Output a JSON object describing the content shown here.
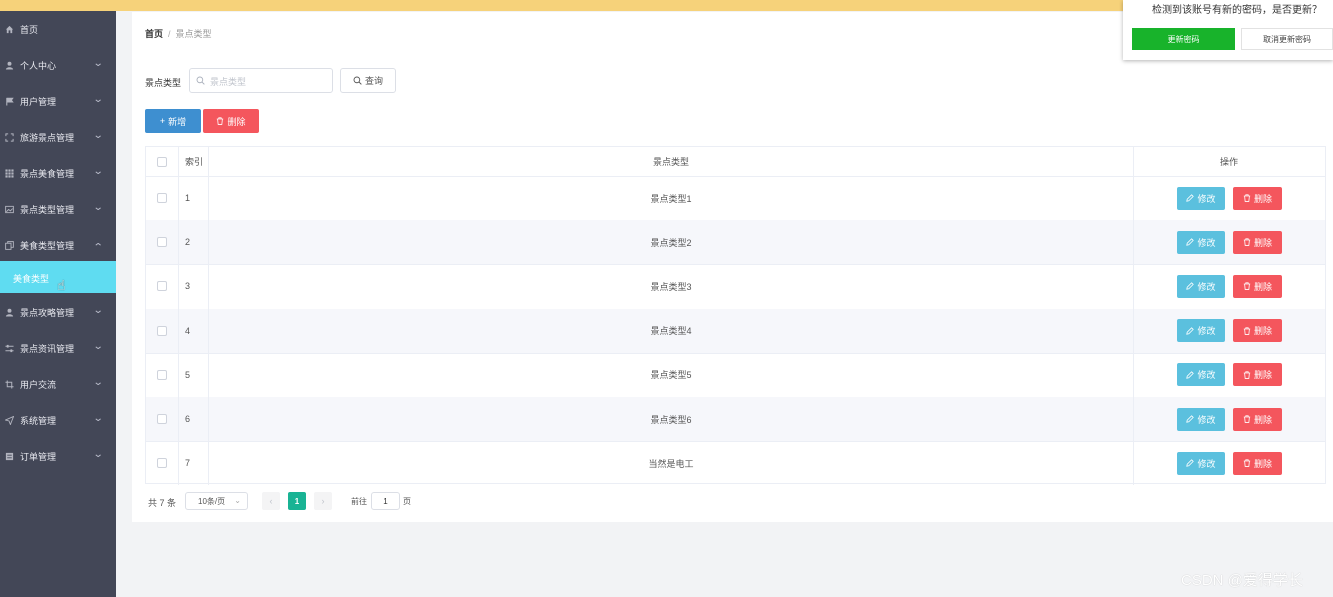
{
  "sidebar": {
    "items": [
      {
        "label": "首页",
        "icon": "home-icon",
        "expandable": false
      },
      {
        "label": "个人中心",
        "icon": "user-icon",
        "expandable": true
      },
      {
        "label": "用户管理",
        "icon": "flag-icon",
        "expandable": true
      },
      {
        "label": "旅游景点管理",
        "icon": "fullscreen-icon",
        "expandable": true
      },
      {
        "label": "景点美食管理",
        "icon": "grid-icon",
        "expandable": true
      },
      {
        "label": "景点类型管理",
        "icon": "picture-icon",
        "expandable": true
      },
      {
        "label": "美食类型管理",
        "icon": "copy-icon",
        "expandable": true,
        "expanded": true
      },
      {
        "label": "景点攻略管理",
        "icon": "user-icon",
        "expandable": true
      },
      {
        "label": "景点资讯管理",
        "icon": "sliders-icon",
        "expandable": true
      },
      {
        "label": "用户交流",
        "icon": "crop-icon",
        "expandable": true
      },
      {
        "label": "系统管理",
        "icon": "send-icon",
        "expandable": true
      },
      {
        "label": "订单管理",
        "icon": "list-icon",
        "expandable": true
      }
    ],
    "active_sub": "美食类型"
  },
  "breadcrumb": {
    "home": "首页",
    "separator": "/",
    "current": "景点类型"
  },
  "search": {
    "label": "景点类型",
    "placeholder": "景点类型",
    "value": "",
    "button": "查询"
  },
  "toolbar": {
    "add": "新增",
    "delete": "删除"
  },
  "table": {
    "headers": {
      "index": "索引",
      "type": "景点类型",
      "ops": "操作"
    },
    "edit_label": "修改",
    "delete_label": "删除",
    "rows": [
      {
        "index": "1",
        "type": "景点类型1"
      },
      {
        "index": "2",
        "type": "景点类型2"
      },
      {
        "index": "3",
        "type": "景点类型3"
      },
      {
        "index": "4",
        "type": "景点类型4"
      },
      {
        "index": "5",
        "type": "景点类型5"
      },
      {
        "index": "6",
        "type": "景点类型6"
      },
      {
        "index": "7",
        "type": "当然是电工"
      }
    ]
  },
  "pagination": {
    "total": "共 7 条",
    "page_size": "10条/页",
    "current_page": "1",
    "goto_label": "前往",
    "goto_value": "1",
    "page_unit": "页"
  },
  "dialog": {
    "message": "检测到该账号有新的密码，是否更新？",
    "confirm": "更新密码",
    "cancel": "取消更新密码"
  },
  "watermark": "CSDN @爱得学长",
  "colors": {
    "sidebar_bg": "#434757",
    "active_sub_bg": "#5fdcf1",
    "primary": "#3e8fd0",
    "danger": "#f4565d",
    "edit": "#5bc0de",
    "pager_active": "#19b394",
    "dialog_ok": "#18b32b",
    "top_band": "#f6d27a"
  }
}
